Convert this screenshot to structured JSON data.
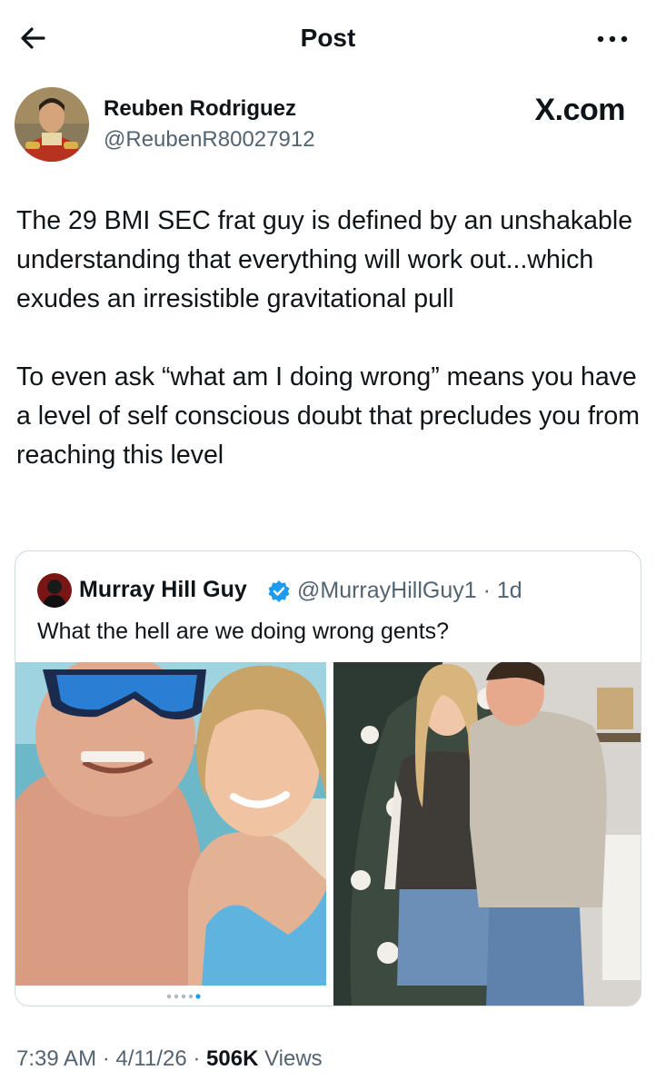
{
  "header": {
    "title": "Post"
  },
  "author": {
    "name": "Reuben Rodriguez",
    "handle": "@ReubenR80027912"
  },
  "watermark": "X.com",
  "post": {
    "paragraphs": [
      "The 29 BMI SEC frat guy is defined by an unshakable understanding that everything will work out...which exudes an irresistible gravitational pull",
      "To even ask “what am I doing wrong” means you have a level of self conscious doubt that precludes you from reaching this level"
    ]
  },
  "quote": {
    "name": "Murray Hill Guy",
    "handle": "@MurrayHillGuy1",
    "separator": "·",
    "age": "1d",
    "text": "What the hell are we doing wrong gents?",
    "verified_color": "#1d9bf0"
  },
  "footer": {
    "time": "7:39 AM",
    "sep1": "·",
    "date": "4/11/26",
    "sep2": "·",
    "views_count": "506K",
    "views_label": "Views"
  },
  "colors": {
    "text": "#0f1419",
    "secondary": "#536471",
    "border": "#cfd9de",
    "accent": "#1d9bf0"
  },
  "icons": {
    "back": "arrow-left-icon",
    "more": "more-horizontal-icon",
    "verified": "verified-badge-icon"
  }
}
